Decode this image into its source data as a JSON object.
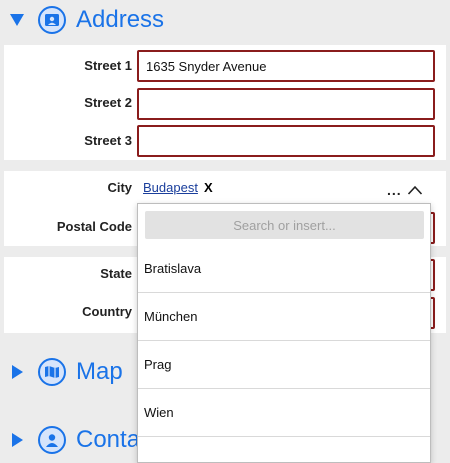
{
  "sections": {
    "address": {
      "title": "Address",
      "icon": "contact-card-icon",
      "expanded": true
    },
    "map": {
      "title": "Map",
      "icon": "map-icon",
      "expanded": false
    },
    "contact": {
      "title": "Conta",
      "icon": "person-icon",
      "expanded": false
    }
  },
  "address_fields": {
    "street1": {
      "label": "Street 1",
      "value": "1635 Snyder Avenue"
    },
    "street2": {
      "label": "Street 2",
      "value": ""
    },
    "street3": {
      "label": "Street 3",
      "value": ""
    },
    "city": {
      "label": "City",
      "value": "Budapest",
      "clear": "X",
      "more": "..."
    },
    "postal_code": {
      "label": "Postal Code",
      "value": ""
    },
    "state": {
      "label": "State",
      "value": ""
    },
    "country": {
      "label": "Country",
      "value": ""
    }
  },
  "city_dropdown": {
    "search_placeholder": "Search or insert...",
    "options": [
      "Bratislava",
      "München",
      "Prag",
      "Wien"
    ]
  },
  "colors": {
    "accent": "#1a73e8",
    "field_border": "#8a1c1c",
    "background": "#ececec"
  }
}
